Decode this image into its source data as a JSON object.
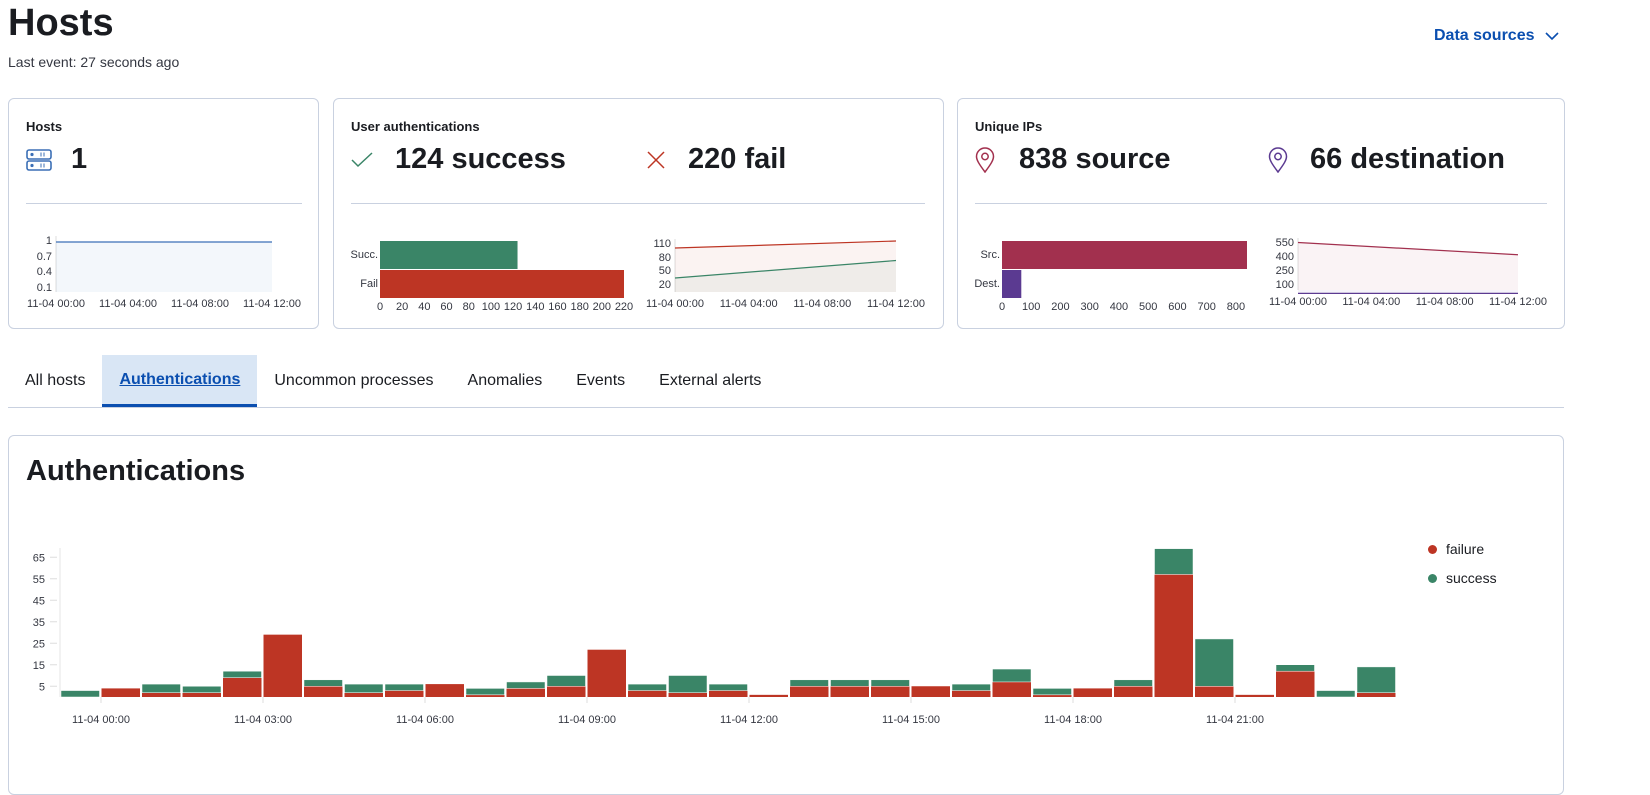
{
  "header": {
    "title": "Hosts",
    "last_event": "Last event: 27 seconds ago",
    "data_sources": "Data sources",
    "chevron_icon": "chevron-down-icon"
  },
  "kpis": {
    "hosts": {
      "title": "Hosts",
      "value": "1",
      "icon": "server-icon",
      "color": "#3b6fb6"
    },
    "auth": {
      "title": "User authentications",
      "success": "124 success",
      "fail": "220 fail",
      "success_icon": "check-icon",
      "fail_icon": "cross-icon",
      "success_color": "#3a8567",
      "fail_color": "#bd3524"
    },
    "ips": {
      "title": "Unique IPs",
      "source": "838 source",
      "destination": "66 destination",
      "source_icon": "map-pin-icon",
      "dest_icon": "map-pin-icon",
      "source_color": "#a2304e",
      "dest_color": "#5b3a91"
    }
  },
  "tabs": [
    {
      "label": "All hosts"
    },
    {
      "label": "Authentications",
      "active": true
    },
    {
      "label": "Uncommon processes"
    },
    {
      "label": "Anomalies"
    },
    {
      "label": "Events"
    },
    {
      "label": "External alerts"
    }
  ],
  "auth_section": {
    "title": "Authentications"
  },
  "chart_data": [
    {
      "type": "area",
      "name": "hosts",
      "y_ticks": [
        "1",
        "0.7",
        "0.4",
        "0.1"
      ],
      "x_ticks": [
        "11-04 00:00",
        "11-04 04:00",
        "11-04 08:00",
        "11-04 12:00"
      ],
      "series": [
        {
          "values": [
            1,
            1
          ],
          "color": "#3b6fb6"
        }
      ]
    },
    {
      "type": "bar",
      "orientation": "horizontal",
      "name": "auth-bar",
      "categories": [
        "Succ.",
        "Fail"
      ],
      "values": [
        124,
        220
      ],
      "colors": [
        "#3a8567",
        "#bd3524"
      ],
      "x_ticks": [
        "0",
        "20",
        "40",
        "60",
        "80",
        "100",
        "120",
        "140",
        "160",
        "180",
        "200",
        "220"
      ],
      "xlim": [
        0,
        220
      ]
    },
    {
      "type": "area",
      "name": "auth-area",
      "y_ticks": [
        "110",
        "80",
        "50",
        "20"
      ],
      "ylim": [
        20,
        110
      ],
      "x_ticks": [
        "11-04 00:00",
        "11-04 04:00",
        "11-04 08:00",
        "11-04 12:00"
      ],
      "series": [
        {
          "values": [
            104,
            118
          ],
          "color": "#bd3524"
        },
        {
          "values": [
            44,
            79
          ],
          "color": "#3a8567"
        }
      ]
    },
    {
      "type": "bar",
      "orientation": "horizontal",
      "name": "ips-bar",
      "categories": [
        "Src.",
        "Dest."
      ],
      "values": [
        838,
        66
      ],
      "colors": [
        "#a2304e",
        "#5b3a91"
      ],
      "x_ticks": [
        "0",
        "100",
        "200",
        "300",
        "400",
        "500",
        "600",
        "700",
        "800"
      ],
      "xlim": [
        0,
        838
      ]
    },
    {
      "type": "area",
      "name": "ips-area",
      "y_ticks": [
        "550",
        "400",
        "250",
        "100"
      ],
      "ylim": [
        100,
        550
      ],
      "x_ticks": [
        "11-04 00:00",
        "11-04 04:00",
        "11-04 08:00",
        "11-04 12:00"
      ],
      "series": [
        {
          "values": [
            565,
            440
          ],
          "color": "#a2304e"
        },
        {
          "values": [
            45,
            45
          ],
          "color": "#5b3a91"
        }
      ]
    },
    {
      "type": "bar",
      "stacked": true,
      "name": "authentications",
      "y_ticks": [
        "65",
        "55",
        "45",
        "35",
        "25",
        "15",
        "5"
      ],
      "x_ticks": [
        "11-04 00:00",
        "11-04 03:00",
        "11-04 06:00",
        "11-04 09:00",
        "11-04 12:00",
        "11-04 15:00",
        "11-04 18:00",
        "11-04 21:00"
      ],
      "series": [
        {
          "name": "failure",
          "color": "#bd3524",
          "values": [
            0,
            4,
            2,
            2,
            9,
            29,
            5,
            2,
            3,
            6,
            1,
            4,
            5,
            22,
            3,
            2,
            3,
            1,
            5,
            5,
            5,
            5,
            3,
            7,
            1,
            4,
            5,
            57,
            5,
            1,
            12,
            0,
            2
          ]
        },
        {
          "name": "success",
          "color": "#3a8567",
          "values": [
            3,
            0,
            4,
            3,
            3,
            0,
            3,
            4,
            3,
            0,
            3,
            3,
            5,
            0,
            3,
            8,
            3,
            0,
            3,
            3,
            3,
            0,
            3,
            6,
            3,
            0,
            3,
            12,
            22,
            0,
            3,
            3,
            12
          ]
        }
      ]
    }
  ]
}
